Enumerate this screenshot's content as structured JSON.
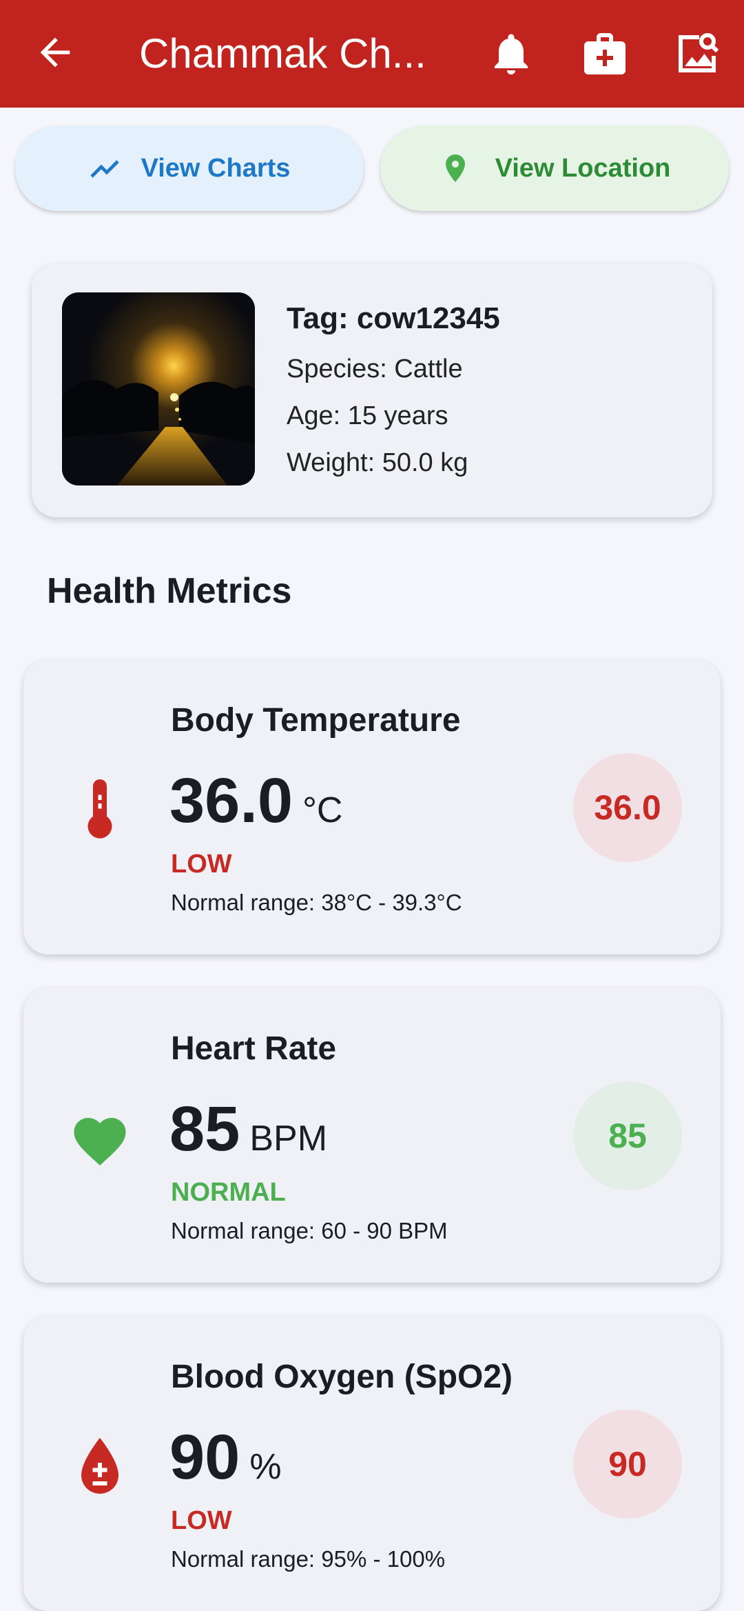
{
  "appbar": {
    "title": "Chammak Ch...",
    "bar_color": "#c1241e",
    "icons": [
      "arrow-back-icon",
      "bell-icon",
      "medical-kit-icon",
      "image-search-icon"
    ]
  },
  "actions": {
    "charts_label": "View Charts",
    "location_label": "View Location"
  },
  "animal": {
    "tag": "Tag: cow12345",
    "species": "Species: Cattle",
    "age": "Age: 15 years",
    "weight": "Weight: 50.0 kg"
  },
  "section_title": "Health Metrics",
  "metrics": [
    {
      "name": "Body Temperature",
      "value": "36.0",
      "unit": "°C",
      "status": "LOW",
      "range": "Normal range: 38°C - 39.3°C",
      "badge": "36.0",
      "icon": "thermometer-icon",
      "color": "#c62a23"
    },
    {
      "name": "Heart Rate",
      "value": "85",
      "unit": "BPM",
      "status": "NORMAL",
      "range": "Normal range: 60 - 90 BPM",
      "badge": "85",
      "icon": "heart-icon",
      "color": "#4caf50"
    },
    {
      "name": "Blood Oxygen (SpO2)",
      "value": "90",
      "unit": "%",
      "status": "LOW",
      "range": "Normal range: 95% - 100%",
      "badge": "90",
      "icon": "blood-drop-icon",
      "color": "#c62a23"
    }
  ]
}
